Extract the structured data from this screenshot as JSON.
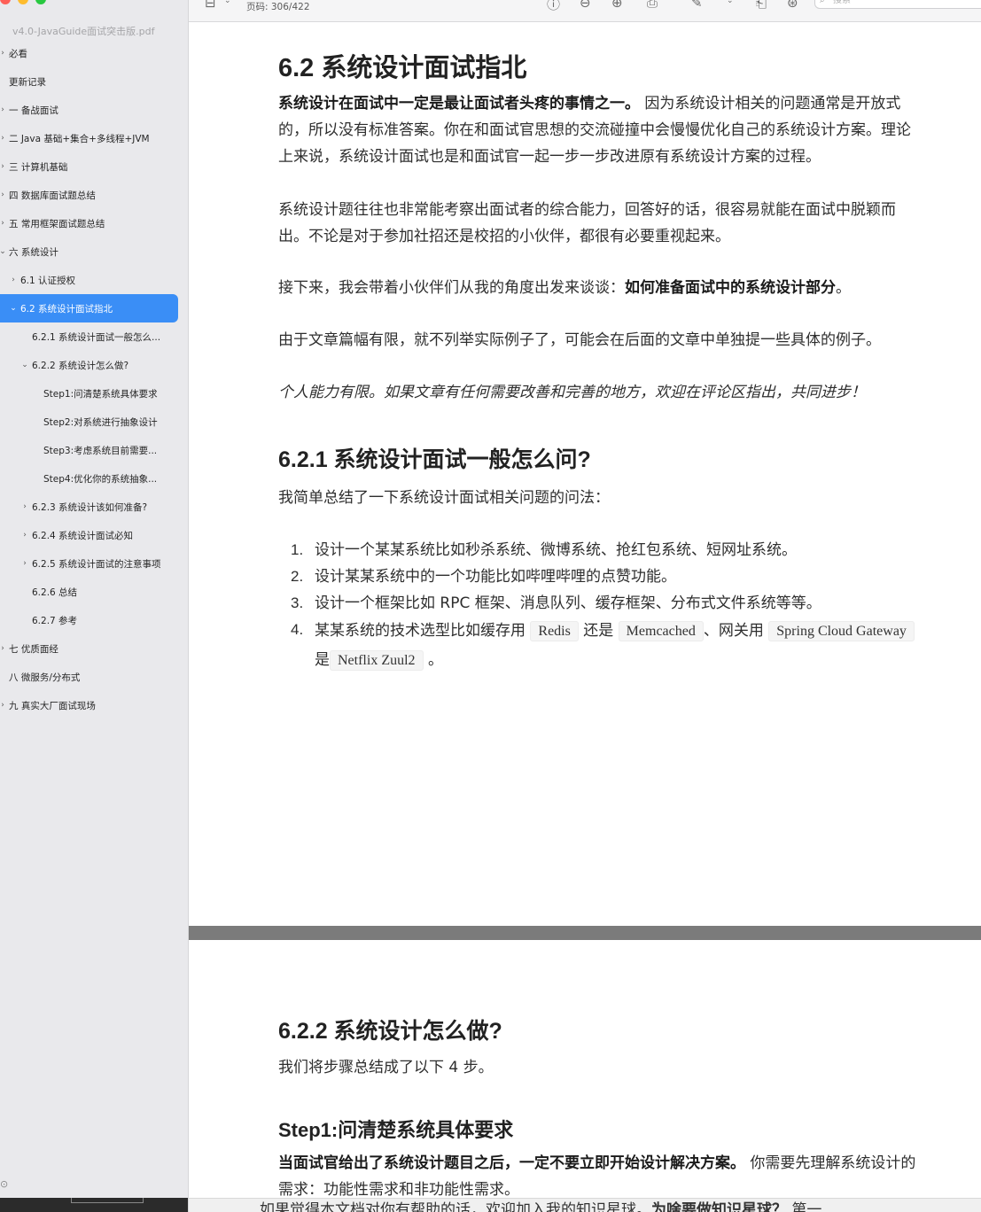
{
  "window": {
    "doc_title": "v4.0-JavaGuide面试突击版.pdf"
  },
  "toolbar": {
    "page_counter": "页码: 306/422",
    "search_placeholder": "搜索",
    "icons": [
      "sidebar-toggle-icon",
      "info-icon",
      "zoom-out-icon",
      "zoom-in-icon",
      "share-icon",
      "markup-icon",
      "chevron-down-icon",
      "rotate-icon",
      "accessibility-icon",
      "search-icon"
    ]
  },
  "sidebar": {
    "accent_color": "#3a8ef6",
    "items": [
      {
        "label": "必看",
        "chevron": "›",
        "indent": 0
      },
      {
        "label": "更新记录",
        "chevron": "",
        "indent": 0
      },
      {
        "label": "一 备战面试",
        "chevron": "›",
        "indent": 0
      },
      {
        "label": "二 Java 基础+集合+多线程+JVM",
        "chevron": "›",
        "indent": 0
      },
      {
        "label": "三 计算机基础",
        "chevron": "›",
        "indent": 0
      },
      {
        "label": "四 数据库面试题总结",
        "chevron": "›",
        "indent": 0
      },
      {
        "label": "五 常用框架面试题总结",
        "chevron": "›",
        "indent": 0
      },
      {
        "label": "六 系统设计",
        "chevron": "⌄",
        "indent": 0
      },
      {
        "label": "6.1 认证授权",
        "chevron": "›",
        "indent": 1
      },
      {
        "label": "6.2 系统设计面试指北",
        "chevron": "⌄",
        "indent": 1,
        "active": true
      },
      {
        "label": "6.2.1 系统设计面试一般怎么...",
        "chevron": "",
        "indent": 2
      },
      {
        "label": "6.2.2 系统设计怎么做?",
        "chevron": "⌄",
        "indent": 2
      },
      {
        "label": "Step1:问清楚系统具体要求",
        "chevron": "",
        "indent": 3
      },
      {
        "label": "Step2:对系统进行抽象设计",
        "chevron": "",
        "indent": 3
      },
      {
        "label": "Step3:考虑系统目前需要...",
        "chevron": "",
        "indent": 3
      },
      {
        "label": "Step4:优化你的系统抽象...",
        "chevron": "",
        "indent": 3
      },
      {
        "label": "6.2.3 系统设计该如何准备?",
        "chevron": "›",
        "indent": 2
      },
      {
        "label": "6.2.4 系统设计面试必知",
        "chevron": "›",
        "indent": 2
      },
      {
        "label": "6.2.5 系统设计面试的注意事项",
        "chevron": "›",
        "indent": 2
      },
      {
        "label": "6.2.6 总结",
        "chevron": "",
        "indent": 2
      },
      {
        "label": "6.2.7 参考",
        "chevron": "",
        "indent": 2
      },
      {
        "label": "七 优质面经",
        "chevron": "›",
        "indent": 0
      },
      {
        "label": "八 微服务/分布式",
        "chevron": "",
        "indent": 0
      },
      {
        "label": "九 真实大厂面试现场",
        "chevron": "›",
        "indent": 0
      }
    ]
  },
  "page1": {
    "h_62": "6.2 系统设计面试指北",
    "intro_bold": "系统设计在面试中一定是最让面试者头疼的事情之一。",
    "intro_l1_rest": " 因为系统设计相关的问题通常是开放式",
    "intro_l2": "的，所以没有标准答案。你在和面试官思想的交流碰撞中会慢慢优化自己的系统设计方案。理论",
    "intro_l3": "上来说，系统设计面试也是和面试官一起一步一步改进原有系统设计方案的过程。",
    "p2_l1": "系统设计题往往也非常能考察出面试者的综合能力，回答好的话，很容易就能在面试中脱颖而",
    "p2_l2": "出。不论是对于参加社招还是校招的小伙伴，都很有必要重视起来。",
    "p3_plain": "接下来，我会带着小伙伴们从我的角度出发来谈谈：",
    "p3_bold": "如何准备面试中的系统设计部分",
    "p3_end": "。",
    "p4": "由于文章篇幅有限，就不列举实际例子了，可能会在后面的文章中单独提一些具体的例子。",
    "p5_italic": "个人能力有限。如果文章有任何需要改善和完善的地方，欢迎在评论区指出，共同进步！",
    "h_621": "6.2.1 系统设计面试一般怎么问?",
    "p6": "我简单总结了一下系统设计面试相关问题的问法：",
    "list": [
      {
        "num": "1.",
        "text": "设计一个某某系统比如秒杀系统、微博系统、抢红包系统、短网址系统。"
      },
      {
        "num": "2.",
        "text": "设计某某系统中的一个功能比如哔哩哔哩的点赞功能。"
      },
      {
        "num": "3.",
        "text": "设计一个框架比如 RPC 框架、消息队列、缓存框架、分布式文件系统等等。"
      }
    ],
    "item4": {
      "num": "4.",
      "a": "某某系统的技术选型比如缓存用",
      "code1": "Redis",
      "b": "还是",
      "code2": "Memcached",
      "c": "、网关用",
      "code3": "Spring Cloud Gateway",
      "d": "是",
      "code4": "Netflix Zuul2",
      "e": "。"
    }
  },
  "page2": {
    "h_622": "6.2.2 系统设计怎么做?",
    "p1": "我们将步骤总结成了以下 4 步。",
    "h_step1": "Step1:问清楚系统具体要求",
    "p2_bold": "当面试官给出了系统设计题目之后，一定不要立即开始设计解决方案。",
    "p2_rest": " 你需要先理解系统设计的",
    "p3": "需求：功能性需求和非功能性需求。"
  },
  "banner": {
    "plain": "如果觉得本文档对你有帮助的话，欢迎加入我的知识星球。",
    "bold": "为啥要做知识星球？",
    "rest": " 第一"
  }
}
